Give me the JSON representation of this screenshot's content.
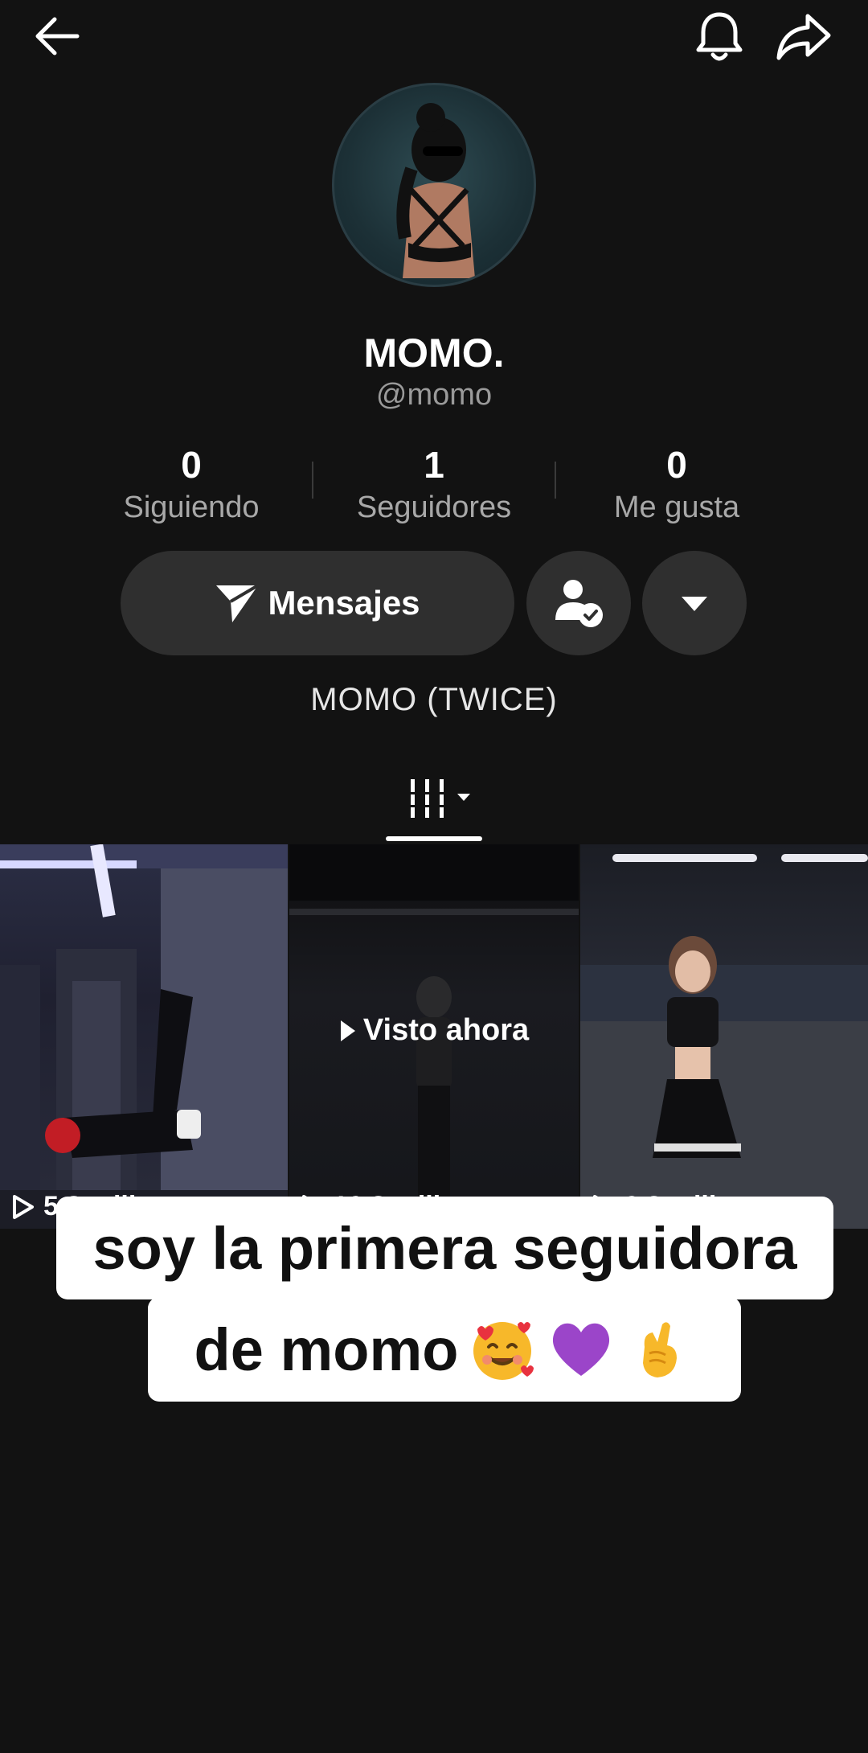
{
  "profile": {
    "name": "MOMO.",
    "handle": "@momo",
    "bio": "MOMO (TWICE)"
  },
  "stats": [
    {
      "value": "0",
      "label": "Siguiendo"
    },
    {
      "value": "1",
      "label": "Seguidores"
    },
    {
      "value": "0",
      "label": "Me gusta"
    }
  ],
  "actions": {
    "message_label": "Mensajes"
  },
  "videos": [
    {
      "views": "5,8 mill."
    },
    {
      "views": "10,8 mill.",
      "overlay": "Visto ahora"
    },
    {
      "views": "6,3 mill."
    }
  ],
  "caption": {
    "line1": "soy la primera seguidora",
    "line2": "de momo"
  },
  "icons": {
    "back": "arrow-left-icon",
    "notifications": "bell-icon",
    "share": "share-arrow-icon",
    "follow_status": "user-check-icon",
    "more": "caret-down-icon",
    "videos_tab": "grid-icon"
  }
}
